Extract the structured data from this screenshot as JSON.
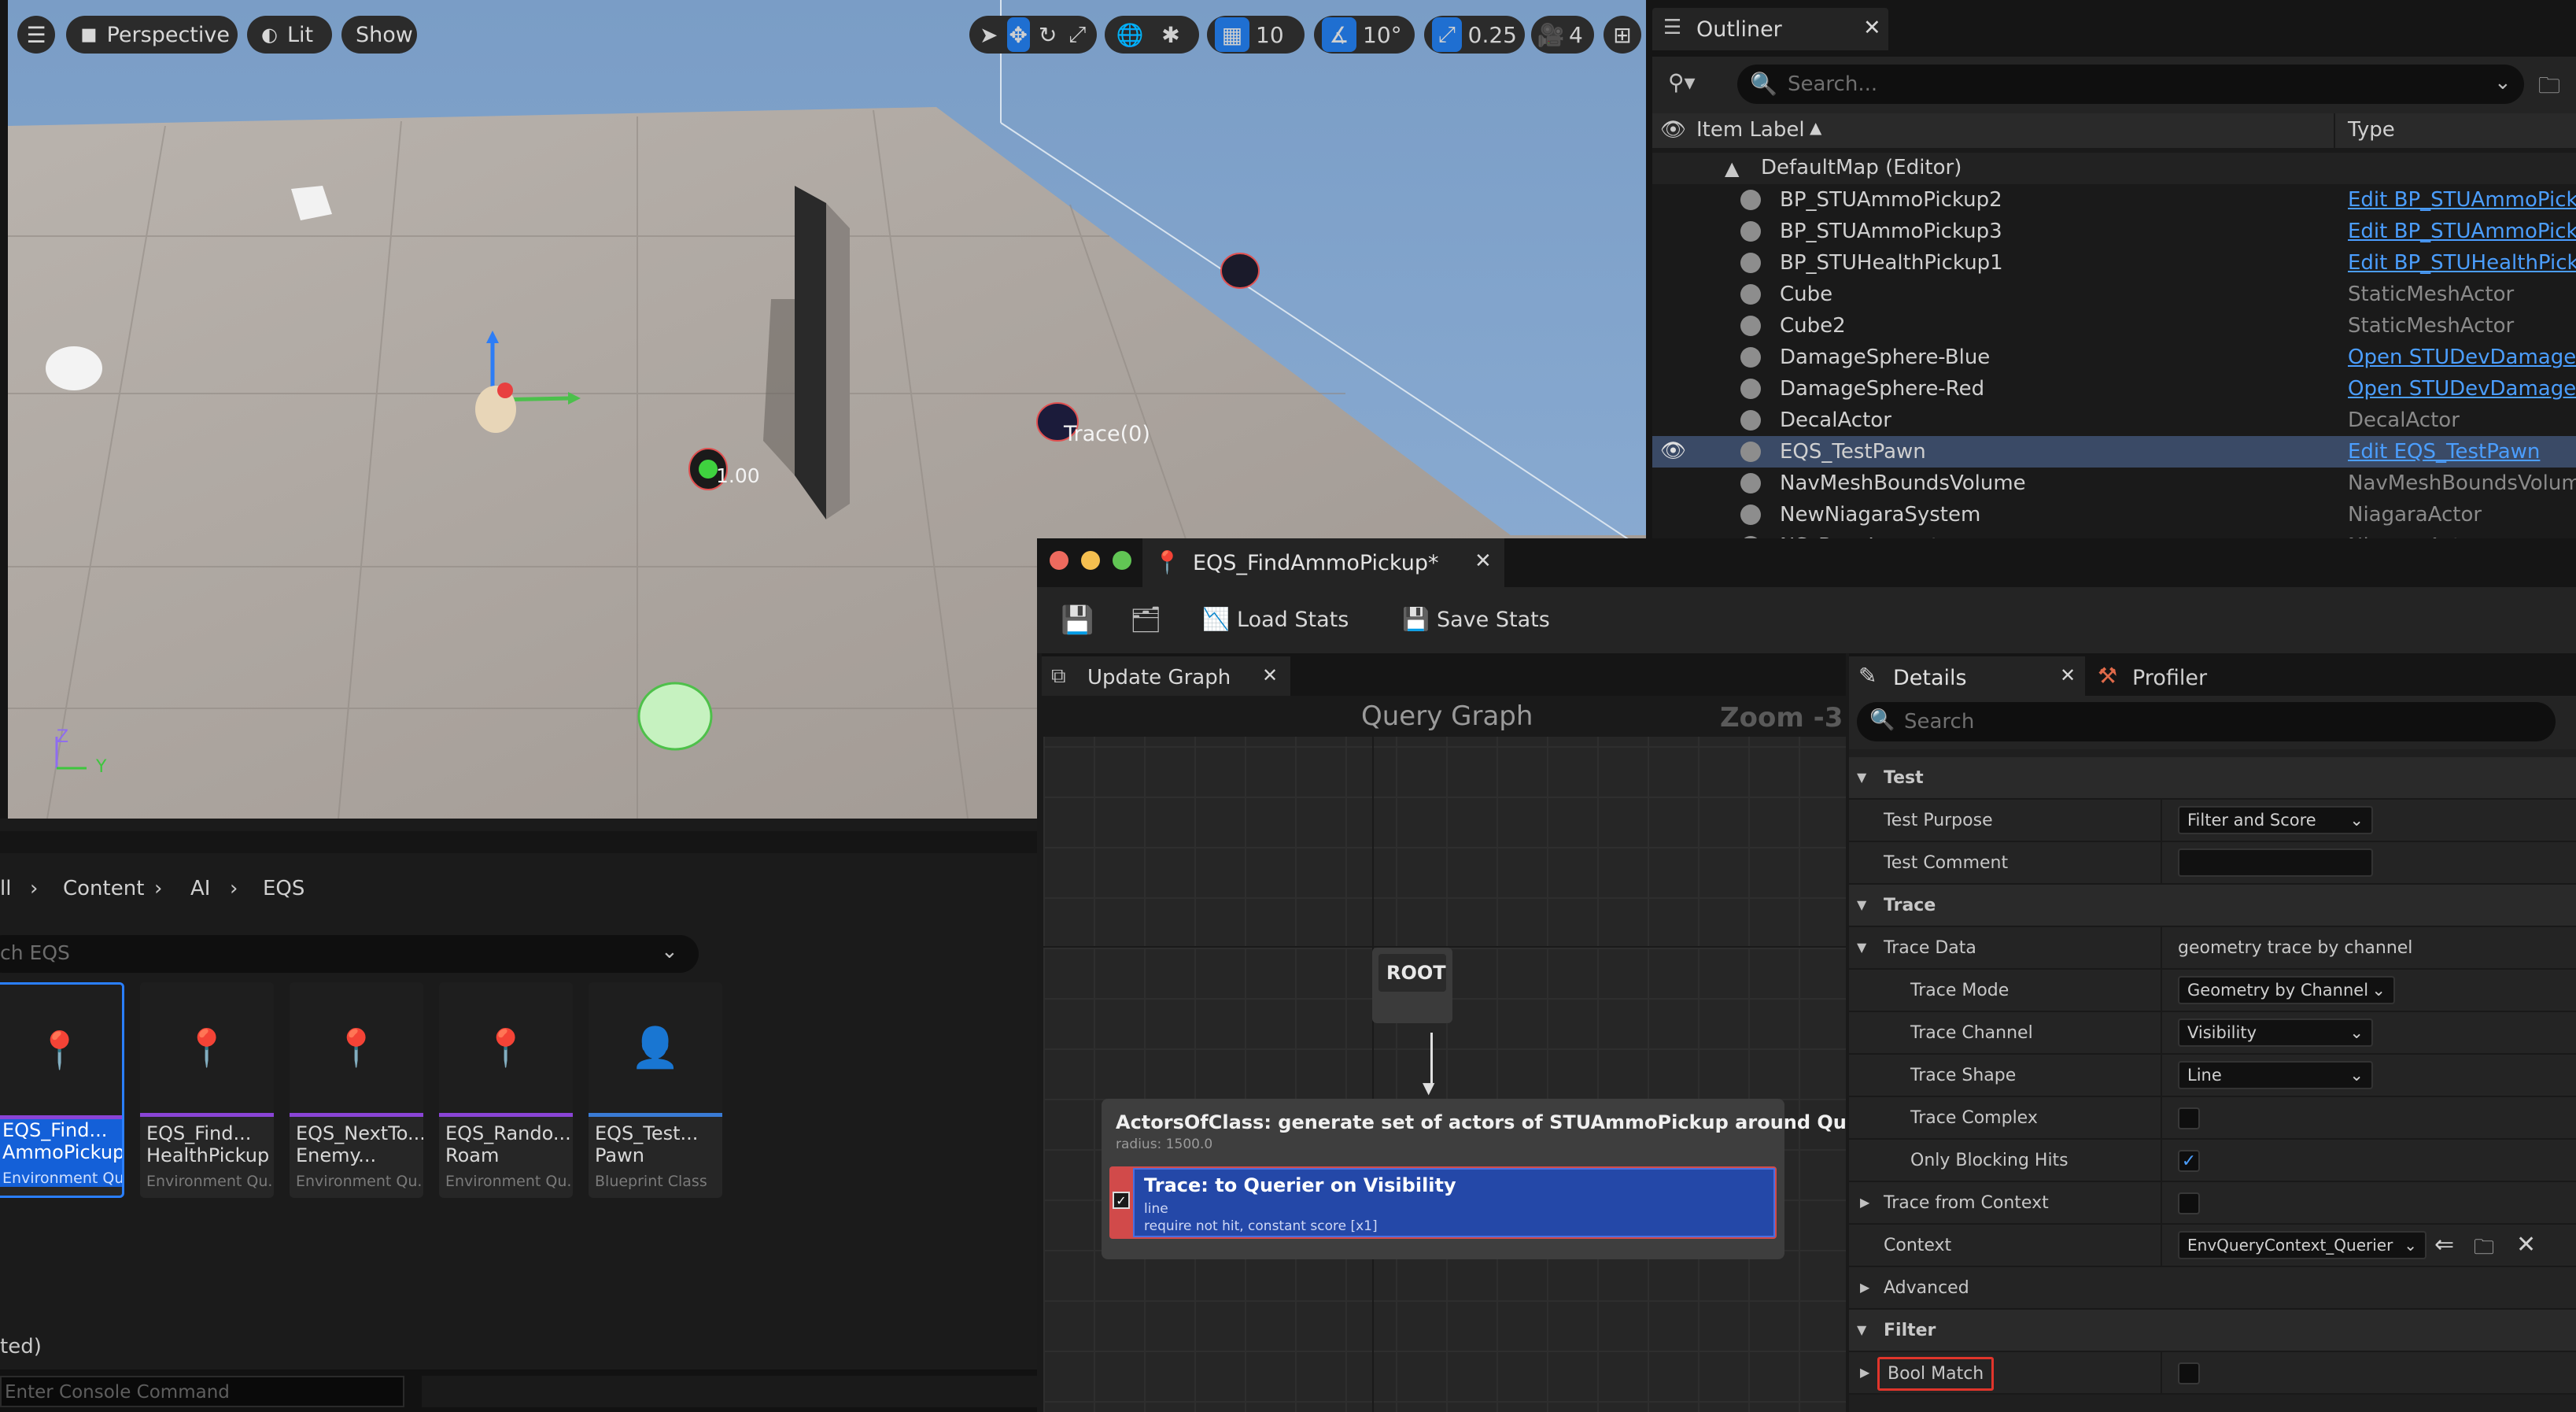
{
  "viewport": {
    "perspective_label": "Perspective",
    "lit_label": "Lit",
    "show_label": "Show",
    "grid_snap_value": "10",
    "rotation_snap_value": "10°",
    "scale_snap_value": "0.25",
    "camera_speed_value": "4",
    "trace_label": "Trace(0)",
    "score_label": "1.00",
    "axis_z": "Z",
    "axis_y": "Y"
  },
  "outliner": {
    "title": "Outliner",
    "search_placeholder": "Search...",
    "col_label": "Item Label",
    "col_type": "Type",
    "map_row": "DefaultMap (Editor)",
    "rows": [
      {
        "label": "BP_STUAmmoPickup2",
        "type": "Edit BP_STUAmmoPickup"
      },
      {
        "label": "BP_STUAmmoPickup3",
        "type": "Edit BP_STUAmmoPickup"
      },
      {
        "label": "BP_STUHealthPickup1",
        "type": "Edit BP_STUHealthPickup"
      },
      {
        "label": "Cube",
        "type": "StaticMeshActor"
      },
      {
        "label": "Cube2",
        "type": "StaticMeshActor"
      },
      {
        "label": "DamageSphere-Blue",
        "type": "Open STUDevDamageActor"
      },
      {
        "label": "DamageSphere-Red",
        "type": "Open STUDevDamageActor"
      },
      {
        "label": "DecalActor",
        "type": "DecalActor"
      },
      {
        "label": "EQS_TestPawn",
        "type": "Edit EQS_TestPawn"
      },
      {
        "label": "NavMeshBoundsVolume",
        "type": "NavMeshBoundsVolume"
      },
      {
        "label": "NewNiagaraSystem",
        "type": "NiagaraActor"
      },
      {
        "label": "NS_BaseImpact",
        "type": "NiagaraActor"
      }
    ]
  },
  "content_browser": {
    "breadcrumb": [
      "ll",
      "Content",
      "AI",
      "EQS"
    ],
    "search_placeholder": "ch EQS",
    "assets": [
      {
        "name": "EQS_Find...\nAmmoPickup",
        "kind": "Environment Qu..."
      },
      {
        "name": "EQS_Find...\nHealthPickup",
        "kind": "Environment Qu..."
      },
      {
        "name": "EQS_NextTo...\nEnemy...",
        "kind": "Environment Qu..."
      },
      {
        "name": "EQS_Rando...\nRoam",
        "kind": "Environment Qu..."
      },
      {
        "name": "EQS_Test...\nPawn",
        "kind": "Blueprint Class"
      }
    ],
    "status_text": "ted)",
    "console_placeholder": "Enter Console Command"
  },
  "eqs_editor": {
    "tab_title": "EQS_FindAmmoPickup*",
    "load_stats": "Load Stats",
    "save_stats": "Save Stats",
    "update_graph_tab": "Update Graph",
    "graph_title": "Query Graph",
    "zoom_label": "Zoom -3",
    "root_label": "ROOT",
    "generator_title": "ActorsOfClass: generate set of actors of STUAmmoPickup around Querier",
    "generator_sub": "radius: 1500.0",
    "test_title": "Trace: to Querier on Visibility",
    "test_line1": "line",
    "test_line2": "require not hit, constant score [x1]"
  },
  "details": {
    "tab_label": "Details",
    "profiler_label": "Profiler",
    "search_placeholder": "Search",
    "sec_test": "Test",
    "test_purpose_label": "Test Purpose",
    "test_purpose_value": "Filter and Score",
    "test_comment_label": "Test Comment",
    "sec_trace": "Trace",
    "trace_data_label": "Trace Data",
    "trace_data_value": "geometry trace by channel",
    "trace_mode_label": "Trace Mode",
    "trace_mode_value": "Geometry by Channel",
    "trace_channel_label": "Trace Channel",
    "trace_channel_value": "Visibility",
    "trace_shape_label": "Trace Shape",
    "trace_shape_value": "Line",
    "trace_complex_label": "Trace Complex",
    "only_blocking_label": "Only Blocking Hits",
    "trace_from_context_label": "Trace from Context",
    "context_label": "Context",
    "context_value": "EnvQueryContext_Querier",
    "advanced_label": "Advanced",
    "sec_filter": "Filter",
    "bool_match_label": "Bool Match"
  }
}
